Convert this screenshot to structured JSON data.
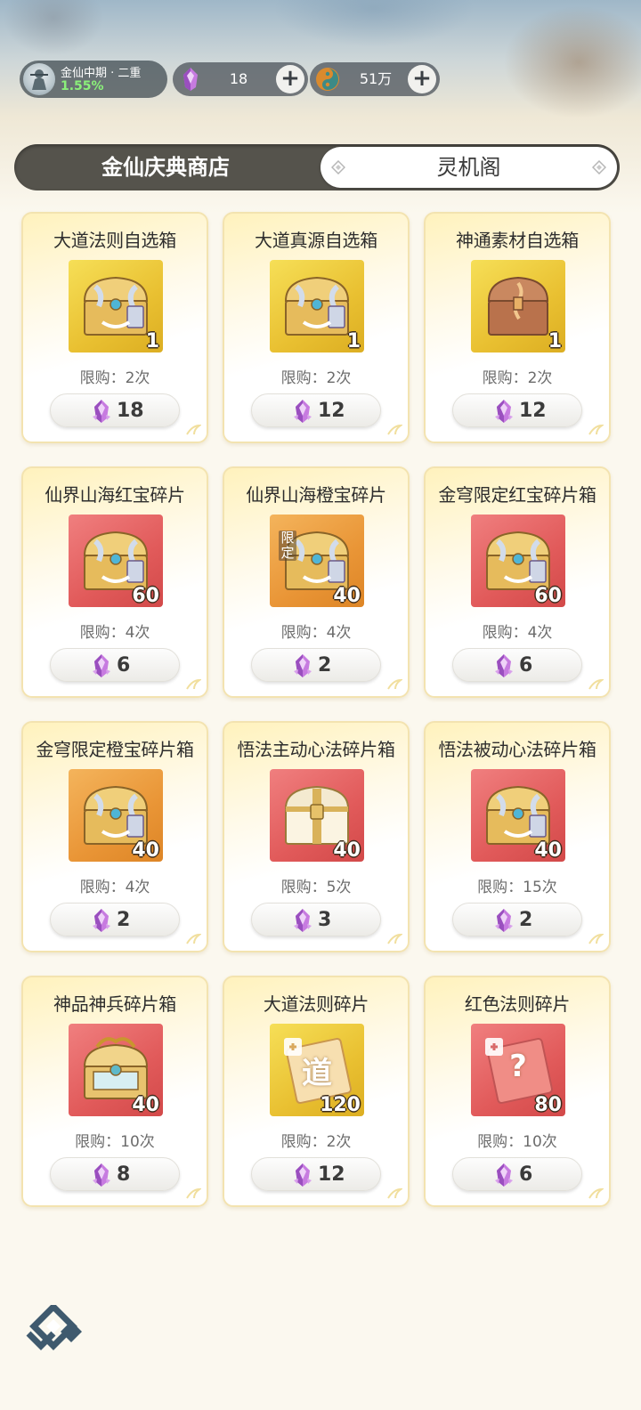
{
  "header": {
    "realm_name": "金仙中期 · 二重",
    "realm_progress": "1.55%",
    "avatar_icon": "cultivator-avatar-icon",
    "gems": {
      "icon": "purple-crystal-icon",
      "value": "18"
    },
    "coins": {
      "icon": "spirit-coin-icon",
      "value": "51万"
    },
    "plus_label": "+"
  },
  "tabs": {
    "active": "金仙庆典商店",
    "other": "灵机阁"
  },
  "shop": {
    "items": [
      {
        "name": "大道法则自选箱",
        "icon": "golden-chest-icon",
        "quality": "gold",
        "qty": "1",
        "limit": "限购：2次",
        "price": "18"
      },
      {
        "name": "大道真源自选箱",
        "icon": "golden-chest-icon",
        "quality": "gold",
        "qty": "1",
        "limit": "限购：2次",
        "price": "12"
      },
      {
        "name": "神通素材自选箱",
        "icon": "bronze-chest-icon",
        "quality": "gold",
        "qty": "1",
        "limit": "限购：2次",
        "price": "12"
      },
      {
        "name": "仙界山海红宝碎片",
        "icon": "golden-chest-icon",
        "quality": "red",
        "qty": "60",
        "limit": "限购：4次",
        "price": "6"
      },
      {
        "name": "仙界山海橙宝碎片",
        "icon": "golden-chest-icon",
        "quality": "orange",
        "qty": "40",
        "limit": "限购：4次",
        "price": "2",
        "tag": "限定"
      },
      {
        "name": "金穹限定红宝碎片箱",
        "icon": "golden-chest-icon",
        "quality": "red",
        "qty": "60",
        "limit": "限购：4次",
        "price": "6"
      },
      {
        "name": "金穹限定橙宝碎片箱",
        "icon": "golden-chest-icon",
        "quality": "orange",
        "qty": "40",
        "limit": "限购：4次",
        "price": "2"
      },
      {
        "name": "悟法主动心法碎片箱",
        "icon": "white-chest-icon",
        "quality": "red",
        "qty": "40",
        "limit": "限购：5次",
        "price": "3"
      },
      {
        "name": "悟法被动心法碎片箱",
        "icon": "golden-chest-icon",
        "quality": "red",
        "qty": "40",
        "limit": "限购：15次",
        "price": "2"
      },
      {
        "name": "神品神兵碎片箱",
        "icon": "dragon-chest-icon",
        "quality": "red",
        "qty": "40",
        "limit": "限购：10次",
        "price": "8"
      },
      {
        "name": "大道法则碎片",
        "icon": "dao-fragment-icon",
        "quality": "gold",
        "qty": "120",
        "limit": "限购：2次",
        "price": "12",
        "glyph": "道"
      },
      {
        "name": "红色法则碎片",
        "icon": "red-fragment-icon",
        "quality": "red",
        "qty": "80",
        "limit": "限购：10次",
        "price": "6",
        "glyph": "?"
      }
    ],
    "price_icon": "purple-crystal-icon"
  },
  "footer": {
    "logo_icon": "game-logo-icon"
  }
}
